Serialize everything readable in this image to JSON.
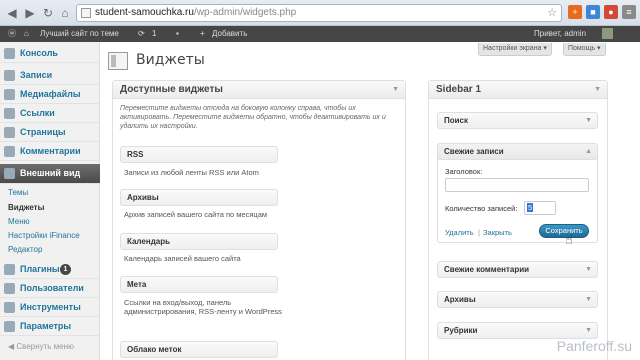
{
  "browser": {
    "url_host": "student-samouchka.ru",
    "url_path": "/wp-admin/widgets.php"
  },
  "adminbar": {
    "site_name": "Лучший сайт по теме",
    "updates_count": "1",
    "add_new": "Добавить",
    "greeting": "Привет, admin"
  },
  "sidebar": {
    "items": [
      {
        "label": "Консоль"
      },
      {
        "label": "Записи"
      },
      {
        "label": "Медиафайлы"
      },
      {
        "label": "Ссылки"
      },
      {
        "label": "Страницы"
      },
      {
        "label": "Комментарии"
      },
      {
        "label": "Внешний вид"
      },
      {
        "label": "Плагины"
      },
      {
        "label": "Пользователи"
      },
      {
        "label": "Инструменты"
      },
      {
        "label": "Параметры"
      }
    ],
    "plugins_badge": "1",
    "submenu": [
      "Темы",
      "Виджеты",
      "Меню",
      "Настройки iFinance",
      "Редактор"
    ],
    "collapse": "Свернуть меню"
  },
  "header": {
    "screen_options": "Настройки экрана",
    "help": "Помощь",
    "page_title": "Виджеты"
  },
  "available": {
    "title": "Доступные виджеты",
    "description": "Переместите виджеты отсюда на боковую колонку справа, чтобы их активировать. Переместите виджеты обратно, чтобы деактивировать их и удалить их настройки.",
    "widgets": [
      {
        "name": "RSS",
        "desc": "Записи из любой ленты RSS или Atom"
      },
      {
        "name": "Архивы",
        "desc": "Архив записей вашего сайта по месяцам"
      },
      {
        "name": "Календарь",
        "desc": "Календарь записей вашего сайта"
      },
      {
        "name": "Мета",
        "desc": "Ссылки на вход/выход, панель администрирования, RSS-ленту и WordPress"
      },
      {
        "name": "Облако меток",
        "desc": ""
      }
    ]
  },
  "sidebar1": {
    "title": "Sidebar 1",
    "widgets": [
      "Поиск",
      "Свежие записи",
      "Свежие комментарии",
      "Архивы",
      "Рубрики"
    ],
    "open_widget": {
      "title_label": "Заголовок:",
      "title_value": "",
      "count_label": "Количество записей:",
      "count_value": "5",
      "delete": "Удалить",
      "separator": "|",
      "close": "Закрыть",
      "save": "Сохранить"
    }
  },
  "watermark": "Panferoff.su"
}
